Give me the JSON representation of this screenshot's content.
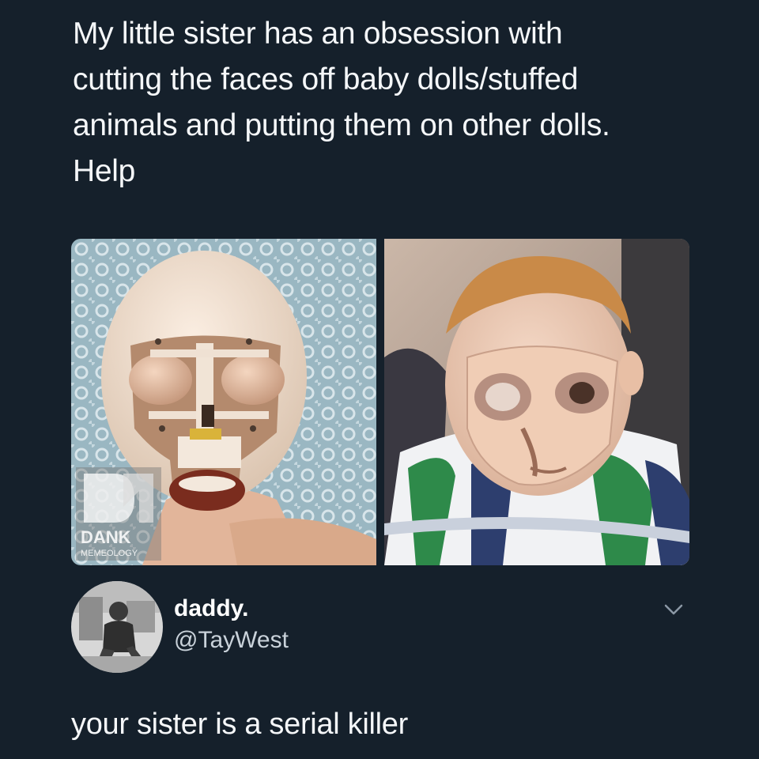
{
  "post": {
    "text": "My little sister has an obsession with\ncutting the faces off baby dolls/stuffed\nanimals and putting them on other dolls.\nHelp"
  },
  "media": {
    "left_image": "doll-without-face",
    "right_image": "doll-with-face-mask",
    "watermark": {
      "line1": "DANK",
      "line2": "MEMEOLOGY"
    }
  },
  "reply": {
    "display_name": "daddy.",
    "handle": "@TayWest",
    "text": "your sister is a serial killer"
  },
  "colors": {
    "background": "#15202b",
    "text": "#f5f7f9",
    "handle": "#c9d2da"
  }
}
